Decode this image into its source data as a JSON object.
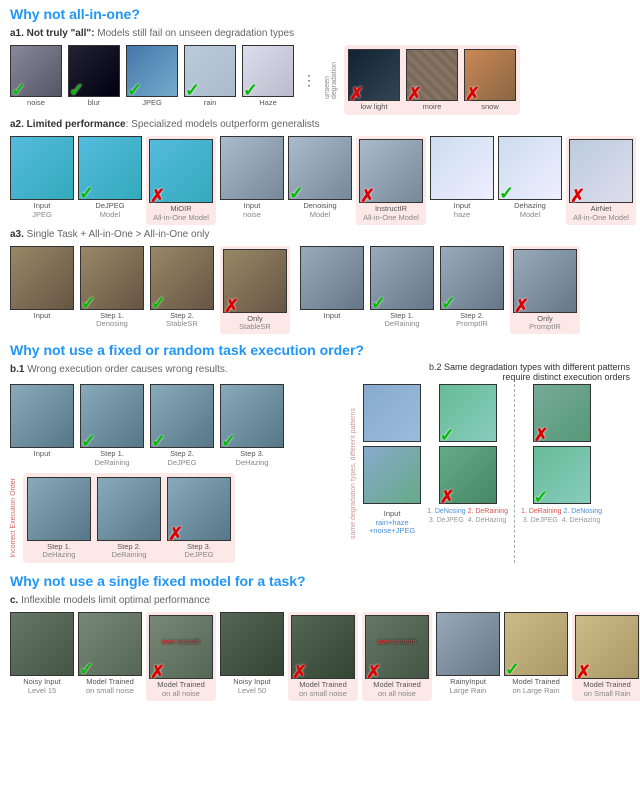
{
  "s1": {
    "title": "Why not all-in-one?",
    "a1": {
      "bold": "a1. Not truly \"all\":",
      "light": " Models still fail on unseen degradation types",
      "left": [
        "noise",
        "blur",
        "JPEG",
        "rain",
        "Haze"
      ],
      "unseen": "unseen\ndegradation",
      "right": [
        "low light",
        "moire",
        "snow"
      ]
    },
    "a2": {
      "bold": "a2. Limited performance",
      "light": ": Specialized models outperform generalists",
      "items": [
        {
          "l": "Input",
          "l2": "JPEG"
        },
        {
          "l": "DeJPEG",
          "l2": "Model",
          "ok": true
        },
        {
          "l": "MiOIR",
          "l2": "All-in-One Model",
          "bad": true
        },
        {
          "l": "Input",
          "l2": "noise"
        },
        {
          "l": "Denoising",
          "l2": "Model",
          "ok": true
        },
        {
          "l": "InstructIR",
          "l2": "All-in-One Model",
          "bad": true
        },
        {
          "l": "Input",
          "l2": "haze"
        },
        {
          "l": "Dehazing",
          "l2": "Model",
          "ok": true
        },
        {
          "l": "AirNet",
          "l2": "All-in-One Model",
          "bad": true
        }
      ]
    },
    "a3": {
      "bold": "a3.",
      "light": " Single Task + All-in-One  >  All-in-One only",
      "g1": [
        "Input",
        "Step 1.\nDenosing",
        "Step 2.\nStableSR",
        "Only\nStableSR"
      ],
      "g2": [
        "Input",
        "Step 1.\nDeRaining",
        "Step 2.\nPromptIR",
        "Only\nPromptIR"
      ]
    }
  },
  "s2": {
    "title": "Why not use a fixed or random task execution order?",
    "b1": {
      "bold": "b.1",
      "light": " Wrong execution order causes wrong results.",
      "top": [
        "Input",
        "Step 1.\nDeRaining",
        "Step 2.\nDeJPEG",
        "Step 3.\nDeHazing"
      ],
      "label": "Incorrect\nExecution Order",
      "bot": [
        "Step 1.\nDeHazing",
        "Step 2.\nDeRaining",
        "Step 3.\nDeJPEG"
      ]
    },
    "b2": {
      "bold": "b.2",
      "light": " Same degradation types with different patterns\nrequire distinct execution orders",
      "sidelabel": "same degradation types, different patterns",
      "inputCap": "Input",
      "inputSub": "rain+haze\n+noise+JPEG",
      "col1": [
        "1. DeNosing",
        "2. DeRaining",
        "3. DeJPEG",
        "4. DeHazing"
      ],
      "col2": [
        "1. DeRaining",
        "2. DeNosing",
        "3. DeJPEG",
        "4. DeHazing"
      ]
    }
  },
  "s3": {
    "title": "Why not use a single fixed model for a task?",
    "c": {
      "bold": "c.",
      "light": " Inflexible models limit optimal performance",
      "items": [
        {
          "l": "Noisy Input",
          "l2": "Level 15"
        },
        {
          "l": "Model Trained",
          "l2": "on small noise",
          "ok": true
        },
        {
          "l": "Model Trained",
          "l2": "on all noise",
          "bad": true,
          "os": "over smooth"
        },
        {
          "l": "Noisy Input",
          "l2": "Level 50"
        },
        {
          "l": "Model Trained",
          "l2": "on small noise",
          "bad": true
        },
        {
          "l": "Model Trained",
          "l2": "on all noise",
          "bad": true,
          "os": "over smooth"
        },
        {
          "l": "RainyInput",
          "l2": "Large Rain"
        },
        {
          "l": "Model Trained",
          "l2": "on Large Rain",
          "ok": true
        },
        {
          "l": "Model Trained",
          "l2": "on Small Rain",
          "bad": true
        }
      ]
    }
  }
}
